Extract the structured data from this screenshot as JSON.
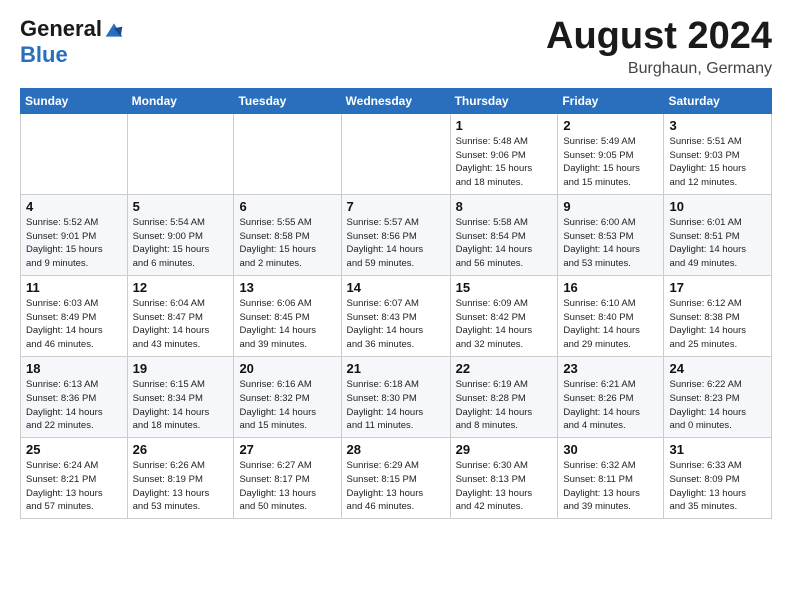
{
  "header": {
    "logo_general": "General",
    "logo_blue": "Blue",
    "month_title": "August 2024",
    "location": "Burghaun, Germany"
  },
  "columns": [
    "Sunday",
    "Monday",
    "Tuesday",
    "Wednesday",
    "Thursday",
    "Friday",
    "Saturday"
  ],
  "rows": [
    [
      {
        "day": "",
        "info": ""
      },
      {
        "day": "",
        "info": ""
      },
      {
        "day": "",
        "info": ""
      },
      {
        "day": "",
        "info": ""
      },
      {
        "day": "1",
        "info": "Sunrise: 5:48 AM\nSunset: 9:06 PM\nDaylight: 15 hours\nand 18 minutes."
      },
      {
        "day": "2",
        "info": "Sunrise: 5:49 AM\nSunset: 9:05 PM\nDaylight: 15 hours\nand 15 minutes."
      },
      {
        "day": "3",
        "info": "Sunrise: 5:51 AM\nSunset: 9:03 PM\nDaylight: 15 hours\nand 12 minutes."
      }
    ],
    [
      {
        "day": "4",
        "info": "Sunrise: 5:52 AM\nSunset: 9:01 PM\nDaylight: 15 hours\nand 9 minutes."
      },
      {
        "day": "5",
        "info": "Sunrise: 5:54 AM\nSunset: 9:00 PM\nDaylight: 15 hours\nand 6 minutes."
      },
      {
        "day": "6",
        "info": "Sunrise: 5:55 AM\nSunset: 8:58 PM\nDaylight: 15 hours\nand 2 minutes."
      },
      {
        "day": "7",
        "info": "Sunrise: 5:57 AM\nSunset: 8:56 PM\nDaylight: 14 hours\nand 59 minutes."
      },
      {
        "day": "8",
        "info": "Sunrise: 5:58 AM\nSunset: 8:54 PM\nDaylight: 14 hours\nand 56 minutes."
      },
      {
        "day": "9",
        "info": "Sunrise: 6:00 AM\nSunset: 8:53 PM\nDaylight: 14 hours\nand 53 minutes."
      },
      {
        "day": "10",
        "info": "Sunrise: 6:01 AM\nSunset: 8:51 PM\nDaylight: 14 hours\nand 49 minutes."
      }
    ],
    [
      {
        "day": "11",
        "info": "Sunrise: 6:03 AM\nSunset: 8:49 PM\nDaylight: 14 hours\nand 46 minutes."
      },
      {
        "day": "12",
        "info": "Sunrise: 6:04 AM\nSunset: 8:47 PM\nDaylight: 14 hours\nand 43 minutes."
      },
      {
        "day": "13",
        "info": "Sunrise: 6:06 AM\nSunset: 8:45 PM\nDaylight: 14 hours\nand 39 minutes."
      },
      {
        "day": "14",
        "info": "Sunrise: 6:07 AM\nSunset: 8:43 PM\nDaylight: 14 hours\nand 36 minutes."
      },
      {
        "day": "15",
        "info": "Sunrise: 6:09 AM\nSunset: 8:42 PM\nDaylight: 14 hours\nand 32 minutes."
      },
      {
        "day": "16",
        "info": "Sunrise: 6:10 AM\nSunset: 8:40 PM\nDaylight: 14 hours\nand 29 minutes."
      },
      {
        "day": "17",
        "info": "Sunrise: 6:12 AM\nSunset: 8:38 PM\nDaylight: 14 hours\nand 25 minutes."
      }
    ],
    [
      {
        "day": "18",
        "info": "Sunrise: 6:13 AM\nSunset: 8:36 PM\nDaylight: 14 hours\nand 22 minutes."
      },
      {
        "day": "19",
        "info": "Sunrise: 6:15 AM\nSunset: 8:34 PM\nDaylight: 14 hours\nand 18 minutes."
      },
      {
        "day": "20",
        "info": "Sunrise: 6:16 AM\nSunset: 8:32 PM\nDaylight: 14 hours\nand 15 minutes."
      },
      {
        "day": "21",
        "info": "Sunrise: 6:18 AM\nSunset: 8:30 PM\nDaylight: 14 hours\nand 11 minutes."
      },
      {
        "day": "22",
        "info": "Sunrise: 6:19 AM\nSunset: 8:28 PM\nDaylight: 14 hours\nand 8 minutes."
      },
      {
        "day": "23",
        "info": "Sunrise: 6:21 AM\nSunset: 8:26 PM\nDaylight: 14 hours\nand 4 minutes."
      },
      {
        "day": "24",
        "info": "Sunrise: 6:22 AM\nSunset: 8:23 PM\nDaylight: 14 hours\nand 0 minutes."
      }
    ],
    [
      {
        "day": "25",
        "info": "Sunrise: 6:24 AM\nSunset: 8:21 PM\nDaylight: 13 hours\nand 57 minutes."
      },
      {
        "day": "26",
        "info": "Sunrise: 6:26 AM\nSunset: 8:19 PM\nDaylight: 13 hours\nand 53 minutes."
      },
      {
        "day": "27",
        "info": "Sunrise: 6:27 AM\nSunset: 8:17 PM\nDaylight: 13 hours\nand 50 minutes."
      },
      {
        "day": "28",
        "info": "Sunrise: 6:29 AM\nSunset: 8:15 PM\nDaylight: 13 hours\nand 46 minutes."
      },
      {
        "day": "29",
        "info": "Sunrise: 6:30 AM\nSunset: 8:13 PM\nDaylight: 13 hours\nand 42 minutes."
      },
      {
        "day": "30",
        "info": "Sunrise: 6:32 AM\nSunset: 8:11 PM\nDaylight: 13 hours\nand 39 minutes."
      },
      {
        "day": "31",
        "info": "Sunrise: 6:33 AM\nSunset: 8:09 PM\nDaylight: 13 hours\nand 35 minutes."
      }
    ]
  ]
}
